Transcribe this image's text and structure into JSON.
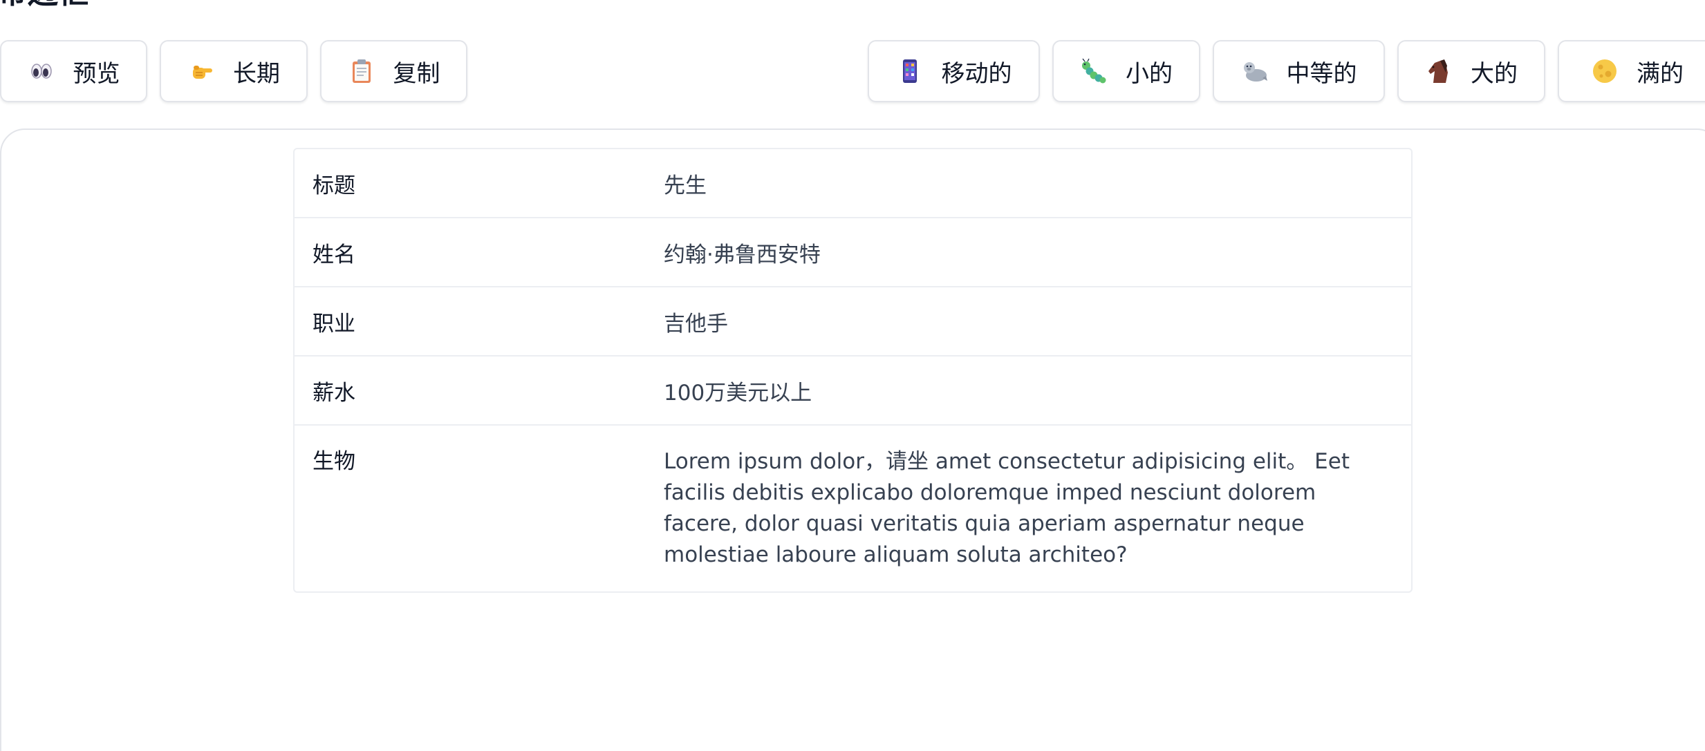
{
  "page": {
    "title": "带边框"
  },
  "toolbar": {
    "left_buttons": [
      {
        "label": "预览",
        "icon": "eyes-icon"
      },
      {
        "label": "长期",
        "icon": "pointing-hand-icon"
      },
      {
        "label": "复制",
        "icon": "clipboard-icon"
      }
    ],
    "right_buttons": [
      {
        "label": "移动的",
        "icon": "mobile-phone-icon"
      },
      {
        "label": "小的",
        "icon": "caterpillar-icon"
      },
      {
        "label": "中等的",
        "icon": "seal-icon"
      },
      {
        "label": "大的",
        "icon": "horse-icon"
      },
      {
        "label": "满的",
        "icon": "full-moon-icon"
      }
    ]
  },
  "details": {
    "rows": [
      {
        "label": "标题",
        "value": "先生"
      },
      {
        "label": "姓名",
        "value": "约翰·弗鲁西安特"
      },
      {
        "label": "职业",
        "value": "吉他手"
      },
      {
        "label": "薪水",
        "value": "100万美元以上"
      },
      {
        "label": "生物",
        "value": "Lorem ipsum dolor，请坐 amet consectetur adipisicing elit。 Eet facilis debitis explicabo doloremque imped nesciunt dolorem facere, dolor quasi veritatis quia aperiam aspernatur neque molestiae laboure aliquam soluta architeo?"
      }
    ]
  },
  "colors": {
    "border": "#e2e4e9",
    "row_divider": "#eceef2",
    "label_text": "#111827",
    "value_text": "#374151"
  }
}
